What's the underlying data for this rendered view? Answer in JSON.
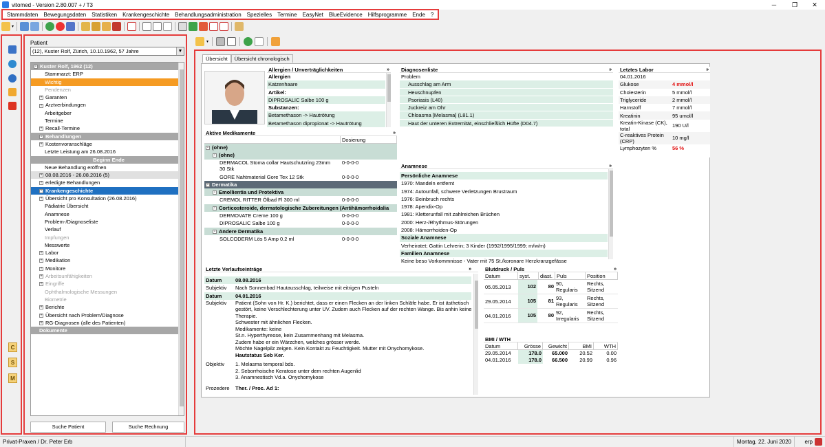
{
  "window": {
    "title": "vitomed  - Version 2.80.007 + / T3"
  },
  "menu": [
    "Stammdaten",
    "Bewegungsdaten",
    "Statistiken",
    "Krankengeschichte",
    "Behandlungsadministration",
    "Spezielles",
    "Termine",
    "EasyNet",
    "BlueEvidence",
    "Hilfsprogramme",
    "Ende",
    "?"
  ],
  "left_strip_letters": [
    "C",
    "S",
    "M"
  ],
  "patient": {
    "label": "Patient",
    "selected": "(12), Kuster Rolf, Zürich, 10.10.1962, 57 Jahre"
  },
  "tree": [
    {
      "t": "Kuster Rolf, 1962 (12)",
      "k": "hdr",
      "ind": 0,
      "pm": "-"
    },
    {
      "t": "Stammarzt: ERP",
      "k": "",
      "ind": 2
    },
    {
      "t": "Wichtig",
      "k": "orange",
      "ind": 2
    },
    {
      "t": "Pendenzen",
      "k": "gray",
      "ind": 2
    },
    {
      "t": "Garanten",
      "k": "",
      "ind": 1,
      "pm": "+"
    },
    {
      "t": "Arztverbindungen",
      "k": "",
      "ind": 1,
      "pm": "+"
    },
    {
      "t": "Arbeitgeber",
      "k": "",
      "ind": 2
    },
    {
      "t": "Termine",
      "k": "",
      "ind": 2
    },
    {
      "t": "Recall-Termine",
      "k": "",
      "ind": 1,
      "pm": "+"
    },
    {
      "t": "Behandlungen",
      "k": "hdr",
      "ind": 1,
      "pm": "-"
    },
    {
      "t": "Kostenvoranschläge",
      "k": "",
      "ind": 1,
      "pm": "+"
    },
    {
      "t": "Letzte Leistung am 26.08.2016",
      "k": "",
      "ind": 2
    },
    {
      "t": "Beginn     Ende",
      "k": "subhdr",
      "ind": 0
    },
    {
      "t": "Neue Behandlung eröffnen",
      "k": "",
      "ind": 2
    },
    {
      "t": "08.08.2016 - 26.08.2016  (5)",
      "k": "sel",
      "ind": 1,
      "pm": "+"
    },
    {
      "t": "erledigte Behandlungen",
      "k": "",
      "ind": 1,
      "pm": "+"
    },
    {
      "t": "Krankengeschichte",
      "k": "hdrblue",
      "ind": 1,
      "pm": "-"
    },
    {
      "t": "Übersicht pro Konsultation (26.08.2016)",
      "k": "",
      "ind": 1,
      "pm": "+"
    },
    {
      "t": "Pädiatrie Übersicht",
      "k": "",
      "ind": 2
    },
    {
      "t": "Anamnese",
      "k": "",
      "ind": 2
    },
    {
      "t": "Problem-/Diagnoseliste",
      "k": "",
      "ind": 2
    },
    {
      "t": "Verlauf",
      "k": "",
      "ind": 2
    },
    {
      "t": "Impfungen",
      "k": "gray",
      "ind": 2
    },
    {
      "t": "Messwerte",
      "k": "",
      "ind": 2
    },
    {
      "t": "Labor",
      "k": "",
      "ind": 1,
      "pm": "+"
    },
    {
      "t": "Medikation",
      "k": "",
      "ind": 1,
      "pm": "+"
    },
    {
      "t": "Monitore",
      "k": "",
      "ind": 1,
      "pm": "+"
    },
    {
      "t": "Arbeitsunfähigkeiten",
      "k": "gray",
      "ind": 1,
      "pm": "+"
    },
    {
      "t": "Eingriffe",
      "k": "gray",
      "ind": 1,
      "pm": "+"
    },
    {
      "t": "Ophthalmologische Messungen",
      "k": "gray",
      "ind": 2
    },
    {
      "t": "Biometrie",
      "k": "gray",
      "ind": 2
    },
    {
      "t": "Berichte",
      "k": "",
      "ind": 1,
      "pm": "+"
    },
    {
      "t": "Übersicht nach Problem/Diagnose",
      "k": "",
      "ind": 1,
      "pm": "+"
    },
    {
      "t": "RG-Diagnosen (alle des Patienten)",
      "k": "",
      "ind": 1,
      "pm": "+"
    },
    {
      "t": "Dokumente",
      "k": "hdr",
      "ind": 1
    }
  ],
  "buttons": {
    "search_patient": "Suche Patient",
    "search_invoice": "Suche Rechnung"
  },
  "tabs": [
    "Übersicht",
    "Übersicht chronologisch"
  ],
  "allergies": {
    "title": "Allergien / Unverträglichkeiten",
    "rows": [
      {
        "t": "Allergien",
        "k": "b"
      },
      {
        "t": "Katzenhaare",
        "k": "g"
      },
      {
        "t": "Artikel:",
        "k": "b"
      },
      {
        "t": "DIPROSALIC Salbe 100 g",
        "k": "g"
      },
      {
        "t": "Substanzen:",
        "k": "b"
      },
      {
        "t": "Betamethason -> Hautrötung",
        "k": "g"
      },
      {
        "t": "Betamethason dipropionat -> Hautrötung",
        "k": "g"
      }
    ]
  },
  "diagnoses": {
    "title": "Diagnosenliste",
    "header": "Problem",
    "rows": [
      "Ausschlag am Arm",
      "Heuschnupfen",
      "Psoriasis (L40)",
      "Juckreiz am Ohr",
      "Chloasma [Melasma] (L81.1)",
      "Haut der unteren Extremität, einschließlich Hüfte (D04.7)"
    ]
  },
  "lab": {
    "title": "Letztes Labor",
    "date": "04.01.2016",
    "rows": [
      {
        "n": "Glukose",
        "v": "4 mmol/l",
        "red": true
      },
      {
        "n": "Cholesterin",
        "v": "5 mmol/l",
        "red": false
      },
      {
        "n": "Triglyceride",
        "v": "2 mmol/l",
        "red": false
      },
      {
        "n": "Harnstoff",
        "v": "7 mmol/l",
        "red": false
      },
      {
        "n": "Kreatinin",
        "v": "95 umol/l",
        "red": false
      },
      {
        "n": "Kreatin-Kinase (CK), total",
        "v": "190 U/l",
        "red": false
      },
      {
        "n": "C-reaktives Protein (CRP)",
        "v": "10 mg/l",
        "red": false
      },
      {
        "n": "Lymphozyten %",
        "v": "56 %",
        "red": true
      }
    ]
  },
  "medications": {
    "title": "Aktive Medikamente",
    "col_dosage": "Dosierung",
    "rows": [
      {
        "t": "(ohne)",
        "d": "",
        "k": "dh2",
        "pm": "-"
      },
      {
        "t": "(ohne)",
        "d": "",
        "k": "dh2",
        "pm": "-",
        "ind": 1
      },
      {
        "t": "DERMACOL Stoma collar Hautschutzring 23mm 30 Stk",
        "d": "0-0-0-0",
        "k": "",
        "ind": 2,
        "tall": true
      },
      {
        "t": "GORE Nahtmaterial Gore Tex 12 Stk",
        "d": "0-0-0-0",
        "k": "",
        "ind": 2
      },
      {
        "t": "Dermatika",
        "d": "",
        "k": "dh",
        "pm": "-"
      },
      {
        "t": "Emollientia und Protektiva",
        "d": "",
        "k": "dh2",
        "pm": "-",
        "ind": 1
      },
      {
        "t": "CREMOL RITTER Ölbad Fl 300 ml",
        "d": "0-0-0-0",
        "k": "",
        "ind": 2
      },
      {
        "t": "Corticosteroide, dermatologische Zubereitungen (Antihämorrhoidalia",
        "d": "",
        "k": "dh2",
        "pm": "-",
        "ind": 1
      },
      {
        "t": "DERMOVATE Creme 100 g",
        "d": "0-0-0-0",
        "k": "",
        "ind": 2
      },
      {
        "t": "DIPROSALIC Salbe 100 g",
        "d": "0-0-0-0",
        "k": "",
        "ind": 2
      },
      {
        "t": "Andere Dermatika",
        "d": "",
        "k": "dh2",
        "pm": "-",
        "ind": 1
      },
      {
        "t": "SOLCODERM Lös 5 Amp 0.2 ml",
        "d": "0-0-0-0",
        "k": "",
        "ind": 2
      }
    ]
  },
  "anamnese": {
    "title": "Anamnese",
    "rows": [
      {
        "t": "Persönliche Anamnese",
        "k": "g b"
      },
      {
        "t": "1970: Mandeln entfernt",
        "k": ""
      },
      {
        "t": "1974: Autounfall, schwere Verletzungen Brustraum",
        "k": ""
      },
      {
        "t": "1976: Beinbruch rechts",
        "k": ""
      },
      {
        "t": "1978: Apendix-Op",
        "k": ""
      },
      {
        "t": "1981: Kletterunfall mit zahlreichen Brüchen",
        "k": ""
      },
      {
        "t": "2000: Herz-/Rhythmus-Störungen",
        "k": ""
      },
      {
        "t": "2008: Hämorrhoiden-Op",
        "k": ""
      },
      {
        "t": "Soziale Anamnese",
        "k": "g b"
      },
      {
        "t": "Verheiratet; Gattin Lehrerin; 3 Kinder (1992/1995/1999; m/w/m)",
        "k": ""
      },
      {
        "t": "Familien Anamnese",
        "k": "g b"
      },
      {
        "t": "Keine beso Vorkommnisse - Vater mit 75 St./koronare Herzkranzgefässe",
        "k": ""
      }
    ]
  },
  "progress": {
    "title": "Letzte Verlaufseinträge",
    "entries": [
      {
        "label": "Datum",
        "text": "08.08.2016",
        "k": "g b"
      },
      {
        "label": "Subjektiv",
        "text": "Nach Sonnenbad Hautausschlag, teilweise mit eitrigen Pusteln",
        "k": ""
      },
      {
        "label": "Datum",
        "text": "04.01.2016",
        "k": "g b"
      }
    ],
    "subj2_label": "Subjektiv",
    "subj2_lines": [
      "Patient (Sohn von Hr. K.) berichtet, dass er einen Flecken an der linken Schläfe habe. Er ist ästhetisch",
      "gestört, keine Verschlechterung unter UV. Zudem auch Flecken auf der rechten Wange. Bis anhin keine",
      "Therapie.",
      "Schwester mit ähnlichen Flecken.",
      "Medikamente: keine",
      "St.n. Hyperthyreose, kein Zusammenhang mit Melasma.",
      "Zudem habe er ein Wärzchen, welches grösser werde.",
      "Möchte Nagelpilz zeigen. Kein Kontakt zu Feuchtigkeit. Mutter mit Onychomykose."
    ],
    "habit": "Hautstatus Seb Ker.",
    "obj_label": "Objektiv",
    "obj_lines": [
      "1. Melasma temporal bds.",
      "2. Seborrhoische Keratose unter dem rechten Augenlid",
      "3. Anamnestisch Vd.a. Onychomykose"
    ],
    "proc_label": "Prozedere",
    "proc_text": "Ther. / Proc. Ad 1:"
  },
  "bp": {
    "title": "Blutdruck / Puls",
    "headers": [
      "Datum",
      "syst.",
      "diast.",
      "Puls",
      "Position"
    ],
    "rows": [
      {
        "d": "05.05.2013",
        "s": "102",
        "di": "80",
        "p": "90, Regularis",
        "pos": "Rechts, Sitzend"
      },
      {
        "d": "29.05.2014",
        "s": "105",
        "di": "81",
        "p": "93, Regularis",
        "pos": "Rechts, Sitzend"
      },
      {
        "d": "04.01.2016",
        "s": "105",
        "di": "80",
        "p": "92, Irregularis",
        "pos": "Rechts, Sitzend"
      }
    ]
  },
  "bmi": {
    "title": "BMI / WTH",
    "headers": [
      "Datum",
      "Grösse",
      "Gewicht",
      "BMI",
      "WTH"
    ],
    "rows": [
      {
        "d": "29.05.2014",
        "g": "178.0",
        "w": "65.000",
        "b": "20.52",
        "t": "0.00"
      },
      {
        "d": "04.01.2016",
        "g": "178.0",
        "w": "66.500",
        "b": "20.99",
        "t": "0.96"
      }
    ]
  },
  "status": {
    "practice": "Privat-Praxen / Dr. Peter Erb",
    "date": "Montag, 22. Juni 2020",
    "user": "erp"
  }
}
